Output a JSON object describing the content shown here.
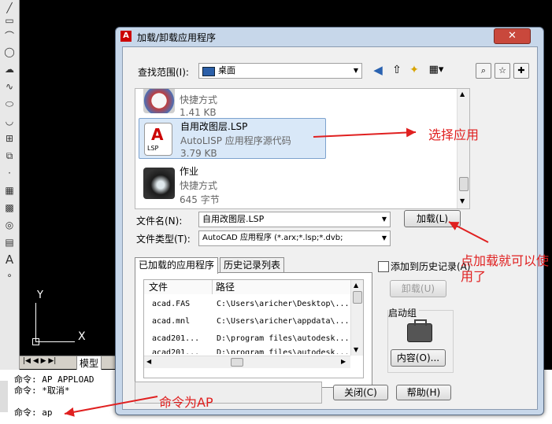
{
  "cad": {
    "tools": [
      "line-icon",
      "rect-icon",
      "arc-icon",
      "circle-icon",
      "cloud-icon",
      "spline-icon",
      "ellipse-icon",
      "ellipse-arc-icon",
      "block-icon",
      "insert-icon",
      "point-icon",
      "hatch-icon",
      "gradient-icon",
      "region-icon",
      "table-icon",
      "text-icon",
      "add-selected-icon"
    ],
    "axis_y": "Y",
    "axis_x": "X",
    "layout_tab": "模型",
    "command_lines": [
      "命令: AP APPLOAD",
      "命令: *取消*",
      "命令: ap"
    ]
  },
  "dialog": {
    "title": "加载/卸载应用程序",
    "close_label": "✕",
    "look_in_label": "查找范围(I):",
    "look_in_value": "桌面",
    "file_list": [
      {
        "name": "",
        "type": "快捷方式",
        "size": "1.41 KB",
        "selected": false
      },
      {
        "name": "自用改图层.LSP",
        "type": "AutoLISP 应用程序源代码",
        "size": "3.79 KB",
        "selected": true
      },
      {
        "name": "作业",
        "type": "快捷方式",
        "size": "645 字节",
        "selected": false
      }
    ],
    "filename_label": "文件名(N):",
    "filename_value": "自用改图层.LSP",
    "filetype_label": "文件类型(T):",
    "filetype_value": "AutoCAD 应用程序 (*.arx;*.lsp;*.dvb;",
    "load_button": "加载(L)",
    "tabs": [
      "已加载的应用程序",
      "历史记录列表"
    ],
    "apps_columns": [
      "文件",
      "路径"
    ],
    "apps_rows": [
      {
        "file": "acad.FAS",
        "path": "C:\\Users\\aricher\\Desktop\\..."
      },
      {
        "file": "acad.mnl",
        "path": "C:\\Users\\aricher\\appdata\\..."
      },
      {
        "file": "acad201...",
        "path": "D:\\program files\\autodesk..."
      },
      {
        "file": "acad201...",
        "path": "D:\\program files\\autodesk..."
      }
    ],
    "add_history_label": "添加到历史记录(A)",
    "unload_button": "卸载(U)",
    "startup_group_label": "启动组",
    "contents_button": "内容(O)...",
    "close_button": "关闭(C)",
    "help_button": "帮助(H)"
  },
  "annotations": {
    "select_app": "选择应用",
    "click_load_1": "点加载就可以使",
    "click_load_2": "用了",
    "command_ap": "命令为AP"
  },
  "colors": {
    "annotation": "#e02020",
    "selection": "#d9e8f8",
    "dialog_frame": "#c7d7ea"
  }
}
